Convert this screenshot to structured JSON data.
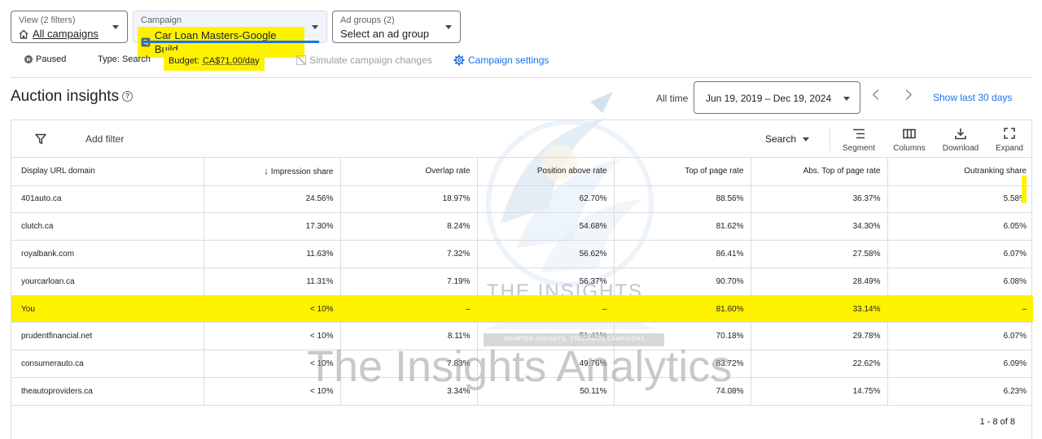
{
  "selectors": {
    "view": {
      "label": "View (2 filters)",
      "value": "All campaigns"
    },
    "campaign": {
      "label": "Campaign",
      "value": "Car Loan Masters-Google Build"
    },
    "ad_groups": {
      "label": "Ad groups (2)",
      "value": "Select an ad group"
    }
  },
  "status_row": {
    "status": "Paused",
    "type": "Type: Search",
    "budget_label": "Budget:",
    "budget_value": "CA$71.00/day",
    "simulate": "Simulate campaign changes",
    "settings": "Campaign settings"
  },
  "header": {
    "title": "Auction insights",
    "all_time": "All time",
    "date_range": "Jun 19, 2019 – Dec 19, 2024",
    "show_last": "Show last 30 days"
  },
  "toolbar": {
    "add_filter": "Add filter",
    "search_scope": "Search",
    "segment": "Segment",
    "columns": "Columns",
    "download": "Download",
    "expand": "Expand"
  },
  "table": {
    "columns": [
      "Display URL domain",
      "Impression share",
      "Overlap rate",
      "Position above rate",
      "Top of page rate",
      "Abs. Top of page rate",
      "Outranking share"
    ],
    "rows": [
      [
        "401auto.ca",
        "24.56%",
        "18.97%",
        "62.70%",
        "88.56%",
        "36.37%",
        "5.58%"
      ],
      [
        "clutch.ca",
        "17.30%",
        "8.24%",
        "54.68%",
        "81.62%",
        "34.30%",
        "6.05%"
      ],
      [
        "royalbank.com",
        "11.63%",
        "7.32%",
        "56.62%",
        "86.41%",
        "27.58%",
        "6.07%"
      ],
      [
        "yourcarloan.ca",
        "11.31%",
        "7.19%",
        "56.37%",
        "90.70%",
        "28.49%",
        "6.08%"
      ],
      [
        "You",
        "< 10%",
        "–",
        "–",
        "81.60%",
        "33.14%",
        "–"
      ],
      [
        "prudentfinancial.net",
        "< 10%",
        "8.11%",
        "51.41%",
        "70.18%",
        "29.78%",
        "6.07%"
      ],
      [
        "consumerauto.ca",
        "< 10%",
        "7.83%",
        "49.76%",
        "83.72%",
        "22.62%",
        "6.09%"
      ],
      [
        "theautoproviders.ca",
        "< 10%",
        "3.34%",
        "50.11%",
        "74.08%",
        "14.75%",
        "6.23%"
      ]
    ]
  },
  "pagination": "1 - 8 of 8",
  "watermark": {
    "title": "THE INSIGHTS",
    "subtitle": "ANALYTICS",
    "tagline": "SMARTER INSIGHTS, STRONGER CAMPAIGNS",
    "text": "The Insights Analytics"
  },
  "colors": {
    "highlight": "#fff200",
    "link": "#1a73e8",
    "border": "#dadce0"
  }
}
